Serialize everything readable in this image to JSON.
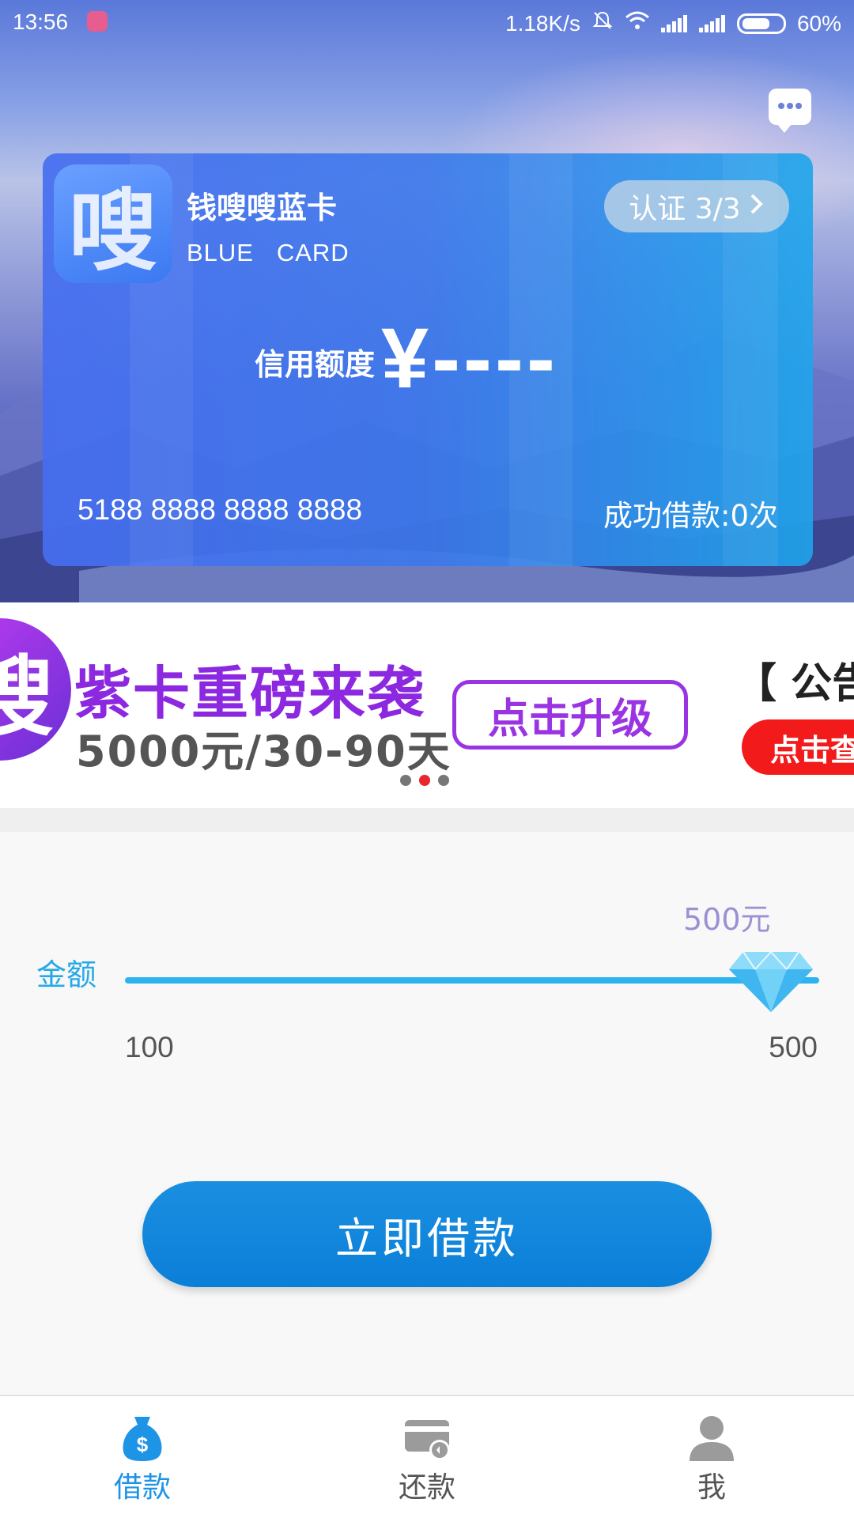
{
  "status_bar": {
    "time": "13:56",
    "network_speed": "1.18K/s",
    "battery": "60%"
  },
  "card": {
    "title": "钱嗖嗖蓝卡",
    "subtitle": "BLUE   CARD",
    "logo_char": "嗖",
    "certification": "认证 3/3",
    "credit_label": "信用额度",
    "credit_value": "¥----",
    "card_number": "5188 8888 8888 8888",
    "loan_count": "成功借款:0次"
  },
  "banner": {
    "logo_char": "嗖",
    "title": "紫卡重磅来袭",
    "subtitle": "5000元/30-90天",
    "upgrade_button": "点击升级",
    "notice": "【 公告",
    "view_button": "点击查",
    "page_count": 3,
    "active_page": 1
  },
  "slider": {
    "label": "金额",
    "current_value": "500元",
    "min_label": "100",
    "max_label": "500",
    "min": 100,
    "max": 500,
    "value": 500
  },
  "borrow_button": "立即借款",
  "nav": {
    "items": [
      {
        "label": "借款",
        "icon": "money-bag-icon",
        "active": true
      },
      {
        "label": "还款",
        "icon": "repay-card-icon",
        "active": false
      },
      {
        "label": "我",
        "icon": "user-icon",
        "active": false
      }
    ]
  },
  "colors": {
    "accent": "#1e94e6",
    "slider": "#2fb3f0",
    "banner_purple": "#8c28e0",
    "banner_red": "#f21a1a"
  }
}
